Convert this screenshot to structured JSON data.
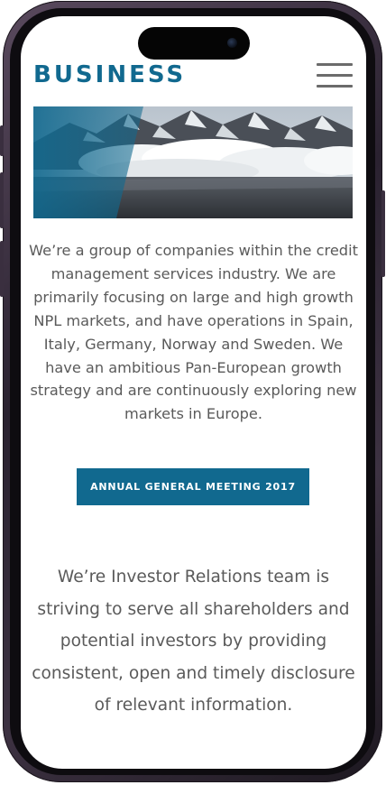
{
  "brand": {
    "logo_text": "BUSINESS",
    "color": "#11698f"
  },
  "header": {
    "menu_icon": "hamburger-menu-icon"
  },
  "hero": {
    "image": "mountain-landscape-with-clouds"
  },
  "intro": {
    "text": "We’re a group of companies within the credit management services industry. We are primarily focusing on large and high growth NPL markets, and have operations in Spain, Italy, Germany, Norway and Sweden. We have an ambitious Pan-European growth strategy and are continuously exploring new markets in Europe."
  },
  "cta": {
    "label": "ANNUAL GENERAL MEETING 2017"
  },
  "investor_relations": {
    "text": "We’re Investor Relations team is striving to serve all shareholders and potential investors by providing consistent, open and timely disclosure of relevant information."
  }
}
